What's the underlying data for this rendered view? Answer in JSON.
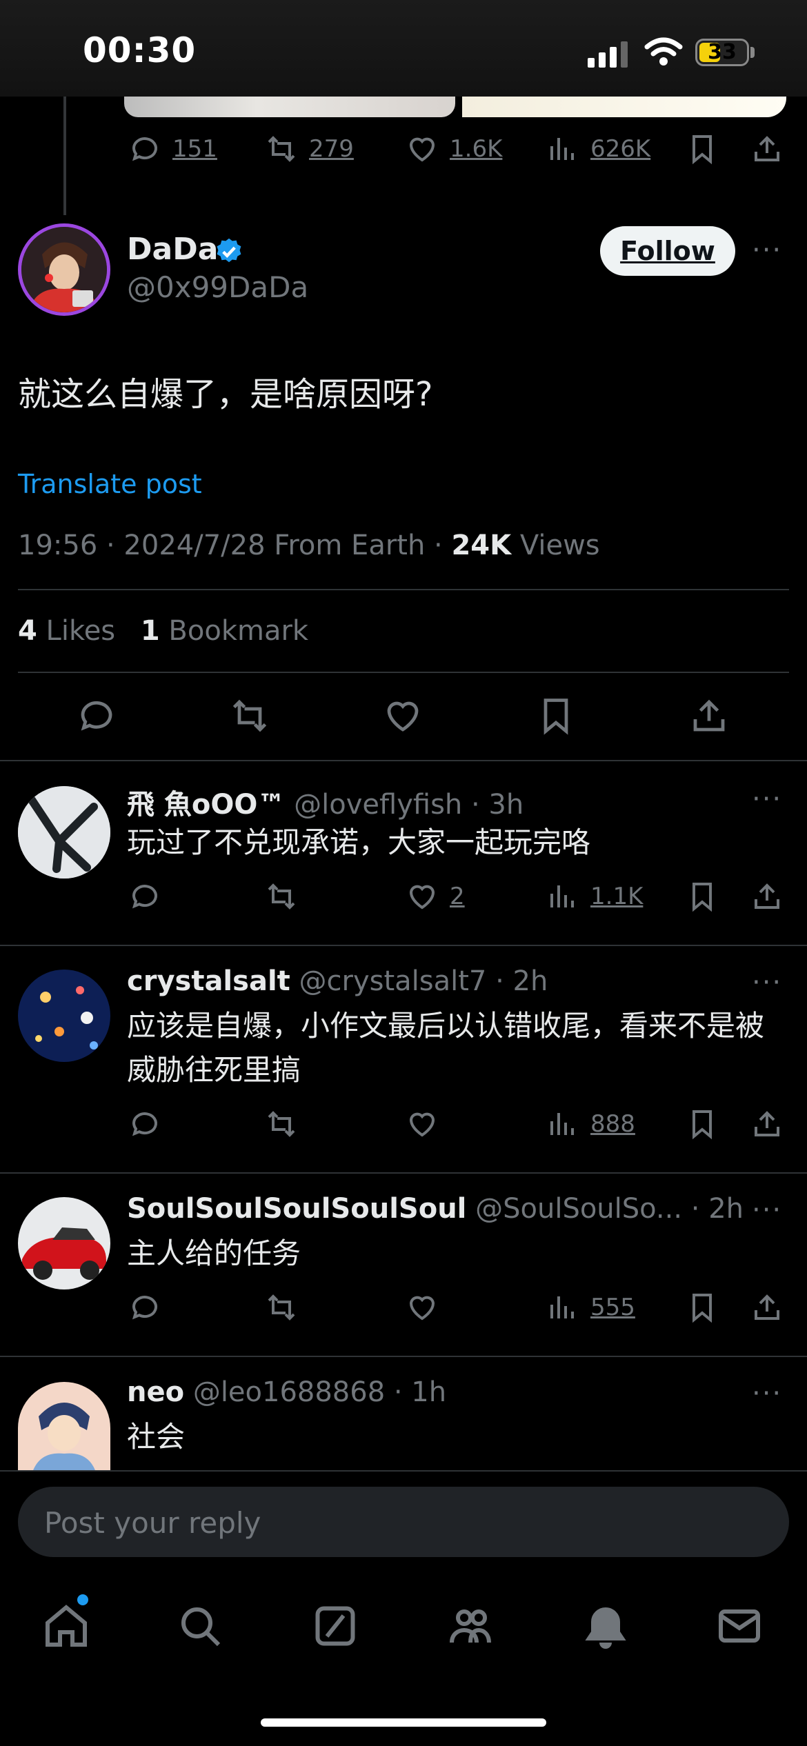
{
  "status_bar": {
    "time": "00:30",
    "battery": "33"
  },
  "prev_post_actions": {
    "replies": "151",
    "reposts": "279",
    "likes": "1.6K",
    "views": "626K"
  },
  "main_post": {
    "name": "DaDa",
    "handle": "@0x99DaDa",
    "follow_label": "Follow",
    "text": "就这么自爆了，是啥原因呀?",
    "translate_label": "Translate post",
    "meta_prefix": "19:56 · 2024/7/28 From Earth · ",
    "views_count": "24K",
    "views_label": " Views",
    "likes_count": "4",
    "likes_label": " Likes",
    "bookmarks_count": "1",
    "bookmarks_label": " Bookmark"
  },
  "replies": [
    {
      "name": "飛 魚oOO™",
      "handle": "@loveflyfish",
      "time": "· 3h",
      "text": "玩过了不兑现承诺，大家一起玩完咯",
      "likes": "2",
      "views": "1.1K"
    },
    {
      "name": "crystalsalt",
      "handle": "@crystalsalt7",
      "time": "· 2h",
      "text": "应该是自爆，小作文最后以认错收尾，看来不是被威胁往死里搞",
      "likes": "",
      "views": "888"
    },
    {
      "name": "SoulSoulSoulSoulSoul",
      "handle": "@SoulSoulSo...",
      "time": "· 2h",
      "text": "主人给的任务",
      "likes": "",
      "views": "555"
    },
    {
      "name": "neo",
      "handle": "@leo1688868",
      "time": "· 1h",
      "text": "社会"
    }
  ],
  "reply_box": {
    "placeholder": "Post your reply"
  },
  "more_glyph": "···",
  "colors": {
    "accent": "#1d9bf0",
    "background": "#000000",
    "secondary_text": "#71767b"
  }
}
